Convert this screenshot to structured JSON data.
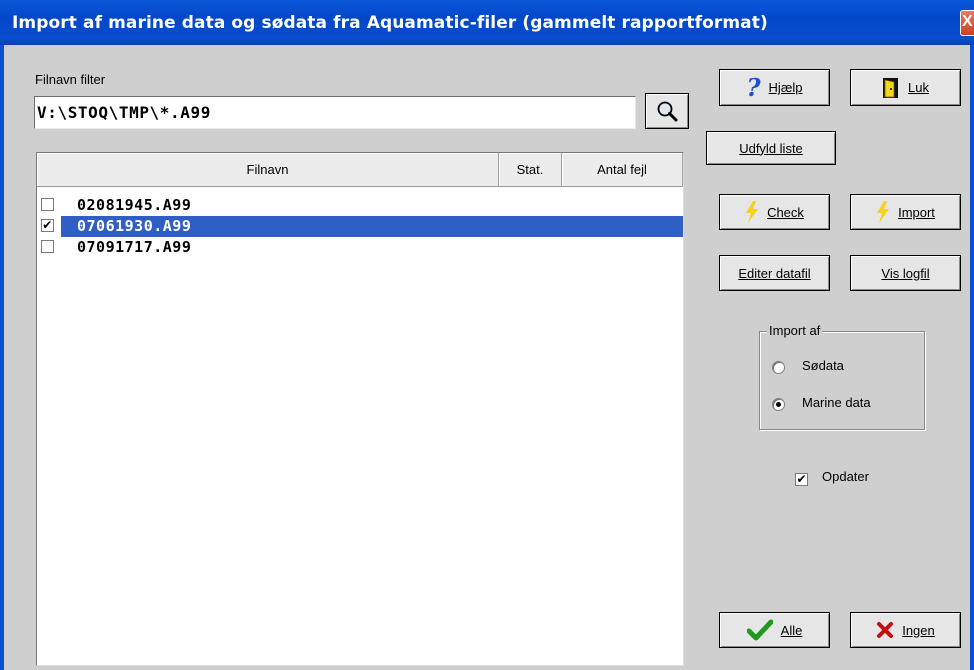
{
  "window": {
    "title": "Import af marine data og sødata fra Aquamatic-filer (gammelt rapportformat)",
    "close_glyph": "X"
  },
  "filter": {
    "label": "Filnavn filter",
    "value": "V:\\STOQ\\TMP\\*.A99",
    "search_icon": "search-icon"
  },
  "list": {
    "columns": [
      "Filnavn",
      "Stat.",
      "Antal fejl"
    ],
    "rows": [
      {
        "checked": false,
        "filename": "02081945.A99",
        "selected": false
      },
      {
        "checked": true,
        "filename": "07061930.A99",
        "selected": true
      },
      {
        "checked": false,
        "filename": "07091717.A99",
        "selected": false
      }
    ],
    "check_mark": "✔"
  },
  "buttons": {
    "help": {
      "label": "Hjælp",
      "icon": "question-icon"
    },
    "close": {
      "label": "Luk",
      "icon": "door-icon"
    },
    "fill_list": {
      "label": "Udfyld liste"
    },
    "check": {
      "label": "Check",
      "icon": "lightning-icon"
    },
    "import": {
      "label": "Import",
      "icon": "lightning-icon"
    },
    "edit_datafile": {
      "label": "Editer datafil"
    },
    "view_logfile": {
      "label": "Vis logfil"
    },
    "all": {
      "label": "Alle",
      "icon": "checkmark-icon"
    },
    "none": {
      "label": "Ingen",
      "icon": "x-icon"
    }
  },
  "import_group": {
    "legend": "Import af",
    "options": [
      "Sødata",
      "Marine data"
    ],
    "selected": "Marine data"
  },
  "update": {
    "label": "Opdater",
    "checked": true
  },
  "colors": {
    "titlebar": "#0347c9",
    "selection": "#2f5fc4",
    "dialog_bg": "#cfcfcf"
  }
}
